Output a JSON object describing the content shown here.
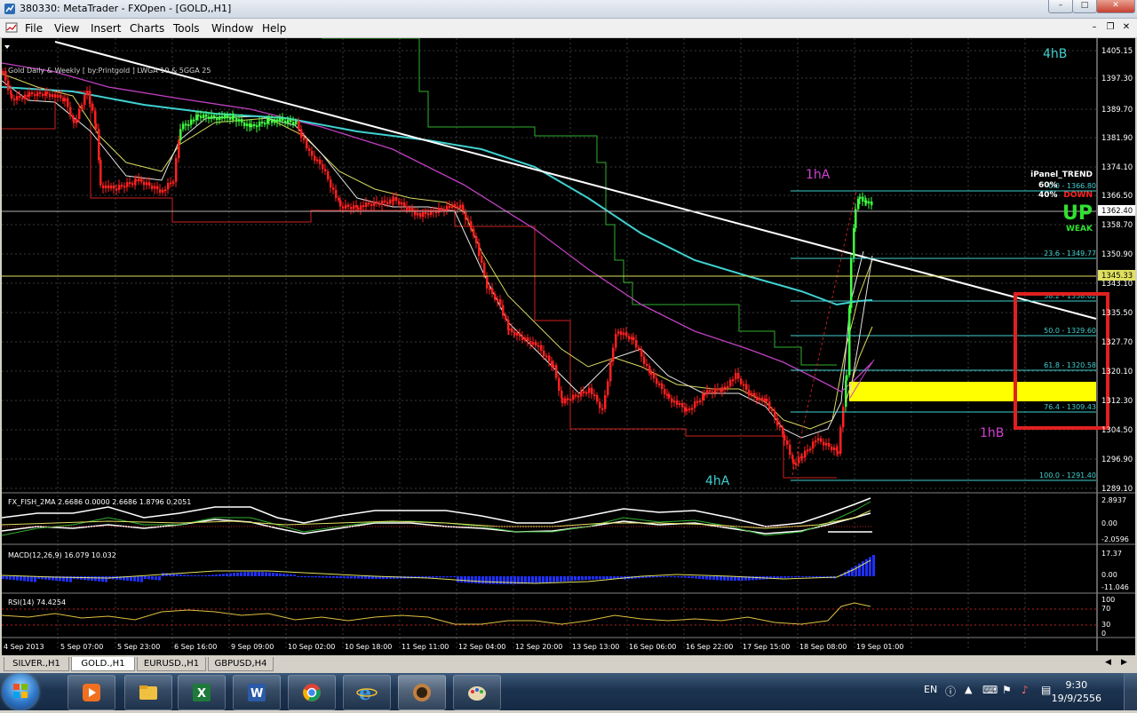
{
  "window": {
    "title": "380330: MetaTrader - FXOpen - [GOLD,,H1]"
  },
  "menu": {
    "items": [
      "File",
      "View",
      "Insert",
      "Charts",
      "Tools",
      "Window",
      "Help"
    ]
  },
  "chart": {
    "indicator_label": "Gold Daily & Weekly [ by:Printgold ] LWGA 10 & 5GGA 25",
    "price_axis": [
      "1405.15",
      "1397.30",
      "1389.70",
      "1381.90",
      "1374.10",
      "1366.50",
      "1358.70",
      "1350.90",
      "1343.10",
      "1335.50",
      "1327.70",
      "1320.10",
      "1312.30",
      "1304.50",
      "1296.90",
      "1289.10"
    ],
    "current_price_labels": [
      "1362.40",
      "1345.33"
    ],
    "time_axis": [
      "4 Sep 2013",
      "5 Sep 07:00",
      "5 Sep 23:00",
      "6 Sep 16:00",
      "9 Sep 09:00",
      "10 Sep 02:00",
      "10 Sep 18:00",
      "11 Sep 11:00",
      "12 Sep 04:00",
      "12 Sep 20:00",
      "13 Sep 13:00",
      "16 Sep 06:00",
      "16 Sep 22:00",
      "17 Sep 15:00",
      "18 Sep 08:00",
      "19 Sep 01:00"
    ],
    "fib_levels": [
      "23.6 - 1349.77",
      "38.2 - 1338.62",
      "50.0 - 1329.60",
      "61.8 - 1320.58",
      "76.4 - 1309.43",
      "100.0 - 1291.40"
    ],
    "fib_top_label": "0.0 - 1366.80",
    "annotations": {
      "h4b": "4hB",
      "h1a": "1hA",
      "h1b": "1hB",
      "h4a": "4hA"
    },
    "ipanel": {
      "title": "iPanel_TREND",
      "pct1": "60%",
      "pct2": "40%",
      "down": "DOWN",
      "up": "UP",
      "weak": "WEAK"
    },
    "colors": {
      "candles": "#ff2020",
      "bullish_candles": "#40ff40",
      "trendline": "#ffffff",
      "fib": "#40e0e0",
      "highlight": "#ffff00",
      "box": "#e02020",
      "ma_cyan": "#40d0d0",
      "ma_magenta": "#d040d0",
      "ma_yellow": "#e0e060",
      "ma_green": "#40c040"
    }
  },
  "fisher": {
    "label": "FX_FISH_2MA 2.6686 0.0000 2.6686 1.8796 0.2051",
    "axis": [
      "2.8937",
      "0.00",
      "-2.0596"
    ]
  },
  "macd": {
    "label": "MACD(12,26,9) 16.079 10.032",
    "axis": [
      "17.37",
      "0.00",
      "-11.046"
    ]
  },
  "rsi": {
    "label": "RSI(14) 74.4254",
    "axis": [
      "100",
      "70",
      "30",
      "0"
    ]
  },
  "tabs": [
    "SILVER.,H1",
    "GOLD.,H1",
    "EURUSD.,H1",
    "GBPUSD,H4"
  ],
  "tabs_active": "GOLD.,H1",
  "taskbar": {
    "lang": "EN",
    "time": "9:30",
    "date": "19/9/2556"
  }
}
